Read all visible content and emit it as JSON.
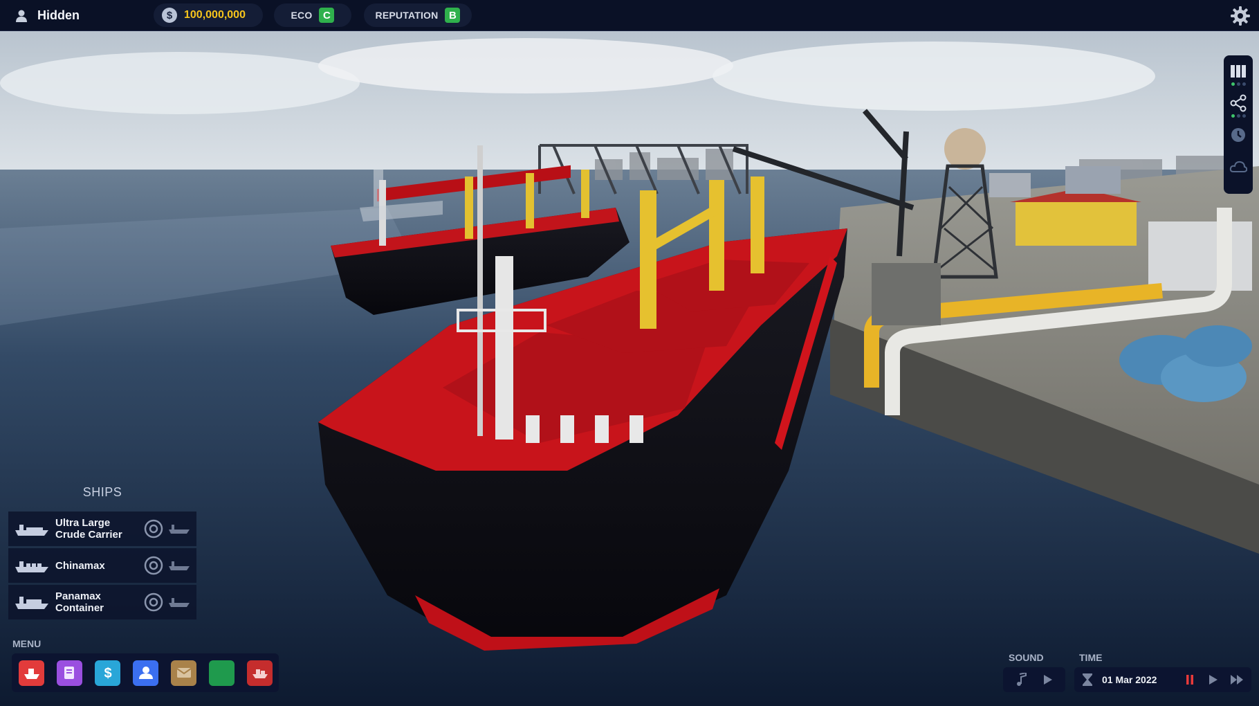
{
  "topbar": {
    "player_name": "Hidden",
    "money_symbol": "$",
    "money": "100,000,000",
    "eco_label": "ECO",
    "eco_grade": "C",
    "eco_color": "#2fb14c",
    "reputation_label": "REPUTATION",
    "reputation_grade": "B",
    "reputation_color": "#2fb14c",
    "icons": [
      "user-icon",
      "dollar-coin-icon",
      "settings-gear-icon"
    ]
  },
  "side_toolbar": {
    "items": [
      {
        "name": "book-icon",
        "active": true
      },
      {
        "name": "network-share-icon",
        "active": true
      },
      {
        "name": "clock-icon",
        "active": false
      },
      {
        "name": "cloud-icon",
        "active": false
      }
    ]
  },
  "ships": {
    "title": "SHIPS",
    "items": [
      {
        "line1": "Ultra Large",
        "line2": "Crude Carrier"
      },
      {
        "line1": "Chinamax",
        "line2": ""
      },
      {
        "line1": "Panamax",
        "line2": "Container"
      }
    ]
  },
  "menu": {
    "title": "MENU",
    "buttons": [
      {
        "icon": "ship-icon",
        "color": "#e23b3b"
      },
      {
        "icon": "documents-icon",
        "color": "#9a4fe0"
      },
      {
        "icon": "dollar-icon",
        "color": "#29a6d8"
      },
      {
        "icon": "people-icon",
        "color": "#3b6ff0"
      },
      {
        "icon": "mail-icon",
        "color": "#a9824a"
      },
      {
        "icon": "blank-green-icon",
        "color": "#1f9a4d"
      },
      {
        "icon": "ship-dock-icon",
        "color": "#c52d2d"
      }
    ]
  },
  "sound": {
    "label": "SOUND"
  },
  "time": {
    "label": "TIME",
    "date": "01 Mar 2022"
  },
  "colors": {
    "hud_bg": "#0a1126",
    "money_yellow": "#f6c41c",
    "pause_red": "#e83a3a"
  }
}
